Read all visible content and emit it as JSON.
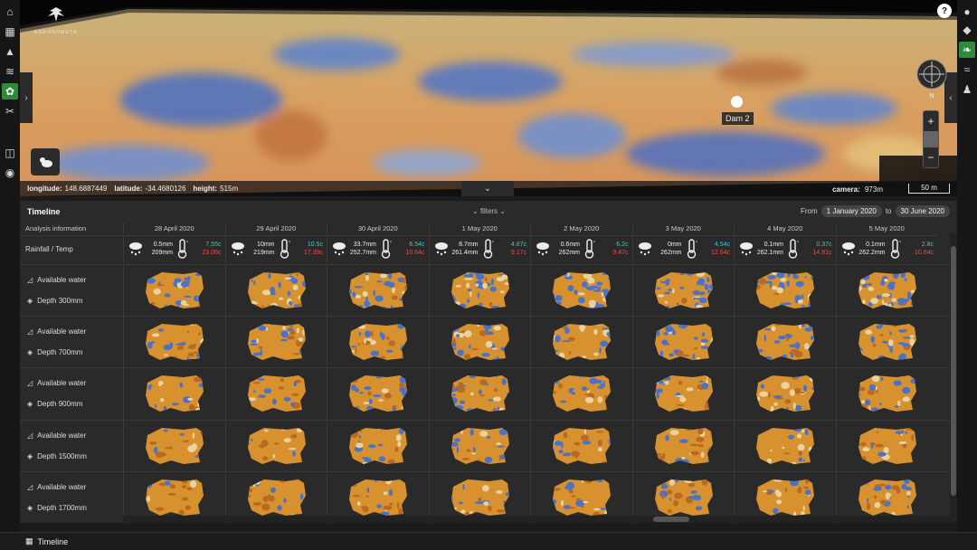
{
  "app": {
    "logo_text": "AGRONOMEYE"
  },
  "map": {
    "status": {
      "longitude_label": "longitude:",
      "longitude": "148.6887449",
      "latitude_label": "latitude:",
      "latitude": "-34.4680126",
      "height_label": "height:",
      "height": "515m"
    },
    "camera_label": "camera:",
    "camera": "973m",
    "scale": "50 m",
    "marker_label": "Dam 2",
    "compass_label": "N",
    "zoom_in": "+",
    "zoom_out": "−"
  },
  "timeline": {
    "title": "Timeline",
    "filters_label": "filters",
    "from_label": "From",
    "from_date": "1 January 2020",
    "to_label": "to",
    "to_date": "30 June 2020",
    "analysis_header": "Analysis information",
    "rainfall_label": "Rainfall / Temp",
    "dates": [
      "28 April 2020",
      "29 April 2020",
      "30 April 2020",
      "1 May 2020",
      "2 May 2020",
      "3 May 2020",
      "4 May 2020",
      "5 May 2020"
    ],
    "weather": [
      {
        "rain": "0.5mm",
        "total": "209mm",
        "tmax": "7.55c",
        "tmin": "23.06c"
      },
      {
        "rain": "10mm",
        "total": "219mm",
        "tmax": "10.5c",
        "tmin": "17.39c"
      },
      {
        "rain": "33.7mm",
        "total": "252.7mm",
        "tmax": "6.54c",
        "tmin": "10.64c"
      },
      {
        "rain": "8.7mm",
        "total": "261.4mm",
        "tmax": "4.87c",
        "tmin": "9.17c"
      },
      {
        "rain": "0.6mm",
        "total": "262mm",
        "tmax": "6.2c",
        "tmin": "9.47c"
      },
      {
        "rain": "0mm",
        "total": "262mm",
        "tmax": "4.54c",
        "tmin": "12.64c"
      },
      {
        "rain": "0.1mm",
        "total": "262.1mm",
        "tmax": "0.37c",
        "tmin": "14.81c"
      },
      {
        "rain": "0.1mm",
        "total": "262.2mm",
        "tmax": "2.8c",
        "tmin": "10.64c"
      }
    ],
    "rows": [
      {
        "type": "Available water",
        "depth": "Depth 300mm",
        "wetness": 0.55
      },
      {
        "type": "Available water",
        "depth": "Depth 700mm",
        "wetness": 0.4
      },
      {
        "type": "Available water",
        "depth": "Depth 900mm",
        "wetness": 0.3
      },
      {
        "type": "Available water",
        "depth": "Depth 1500mm",
        "wetness": 0.15
      },
      {
        "type": "Available water",
        "depth": "Depth 1700mm",
        "wetness": 0.2
      }
    ]
  },
  "bottom": {
    "timeline_label": "Timeline"
  },
  "colors": {
    "accent": "#2f8a3a",
    "temp_max": "#3fc8c8",
    "temp_min": "#e05050"
  }
}
